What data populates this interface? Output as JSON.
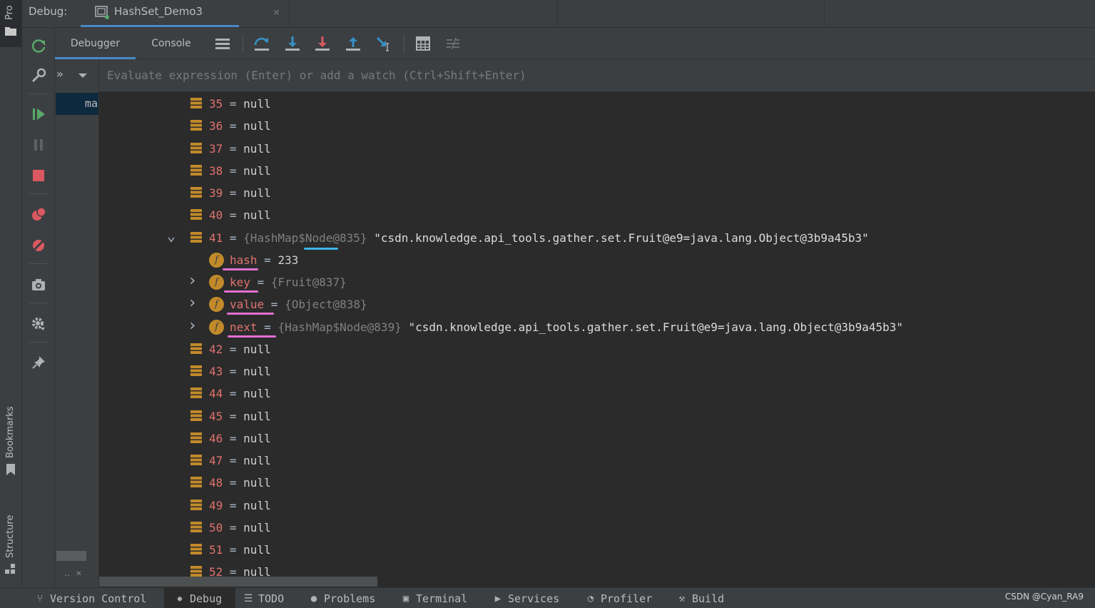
{
  "header": {
    "debug_label": "Debug:",
    "session_tab": "HashSet_Demo3",
    "close_glyph": "×"
  },
  "left_strip": {
    "project_label": "Pro",
    "bookmarks_label": "Bookmarks",
    "structure_label": "Structure"
  },
  "side_toolbar": {
    "icons": [
      "rerun-icon",
      "wrench-icon",
      "resume-icon",
      "pause-icon",
      "stop-icon",
      "view-breakpoints-icon",
      "mute-breakpoints-icon",
      "camera-icon",
      "settings-icon",
      "pin-icon"
    ]
  },
  "tabs": {
    "debugger": "Debugger",
    "console": "Console"
  },
  "toolbar_icons": [
    "menu-icon",
    "step-over-icon",
    "step-into-icon",
    "force-step-into-icon",
    "step-out-icon",
    "run-to-cursor-icon",
    "evaluate-icon",
    "trace-icon"
  ],
  "frames": {
    "chevrons": "»",
    "selected_frame": "ma",
    "ctrl": "‥ ✕"
  },
  "evaluate": {
    "placeholder": "Evaluate expression (Enter) or add a watch (Ctrl+Shift+Enter)"
  },
  "tree": {
    "null_rows_top": [
      {
        "index": "35",
        "value": "null"
      },
      {
        "index": "36",
        "value": "null"
      },
      {
        "index": "37",
        "value": "null"
      },
      {
        "index": "38",
        "value": "null"
      },
      {
        "index": "39",
        "value": "null"
      },
      {
        "index": "40",
        "value": "null"
      }
    ],
    "expanded": {
      "index": "41",
      "ref": "{HashMap$Node@835}",
      "string": "\"csdn.knowledge.api_tools.gather.set.Fruit@e9=java.lang.Object@3b9a45b3\"",
      "fields": [
        {
          "name": "hash",
          "value": "233",
          "is_ref": false
        },
        {
          "name": "key",
          "value": "{Fruit@837}",
          "is_ref": true
        },
        {
          "name": "value",
          "value": "{Object@838}",
          "is_ref": true
        },
        {
          "name": "next",
          "value": "{HashMap$Node@839}",
          "is_ref": true,
          "string": "\"csdn.knowledge.api_tools.gather.set.Fruit@e9=java.lang.Object@3b9a45b3\""
        }
      ]
    },
    "null_rows_bottom": [
      {
        "index": "42",
        "value": "null"
      },
      {
        "index": "43",
        "value": "null"
      },
      {
        "index": "44",
        "value": "null"
      },
      {
        "index": "45",
        "value": "null"
      },
      {
        "index": "46",
        "value": "null"
      },
      {
        "index": "47",
        "value": "null"
      },
      {
        "index": "48",
        "value": "null"
      },
      {
        "index": "49",
        "value": "null"
      },
      {
        "index": "50",
        "value": "null"
      },
      {
        "index": "51",
        "value": "null"
      },
      {
        "index": "52",
        "value": "null"
      }
    ],
    "equals": "="
  },
  "statusbar": {
    "items": [
      {
        "label": "Version Control",
        "icon": "version-control-icon",
        "active": false
      },
      {
        "label": "Debug",
        "icon": "debug-icon",
        "active": true
      },
      {
        "label": "TODO",
        "icon": "todo-icon",
        "active": false
      },
      {
        "label": "Problems",
        "icon": "problems-icon",
        "active": false
      },
      {
        "label": "Terminal",
        "icon": "terminal-icon",
        "active": false
      },
      {
        "label": "Services",
        "icon": "services-icon",
        "active": false
      },
      {
        "label": "Profiler",
        "icon": "profiler-icon",
        "active": false
      },
      {
        "label": "Build",
        "icon": "build-icon",
        "active": false
      }
    ],
    "watermark": "CSDN @Cyan_RA9"
  },
  "colors": {
    "index": "#e0726e",
    "field_icon": "#c28a2a",
    "annotation_pink": "#e36fd3",
    "annotation_blue": "#3fb5e8",
    "tab_underline": "#4a88c7"
  }
}
